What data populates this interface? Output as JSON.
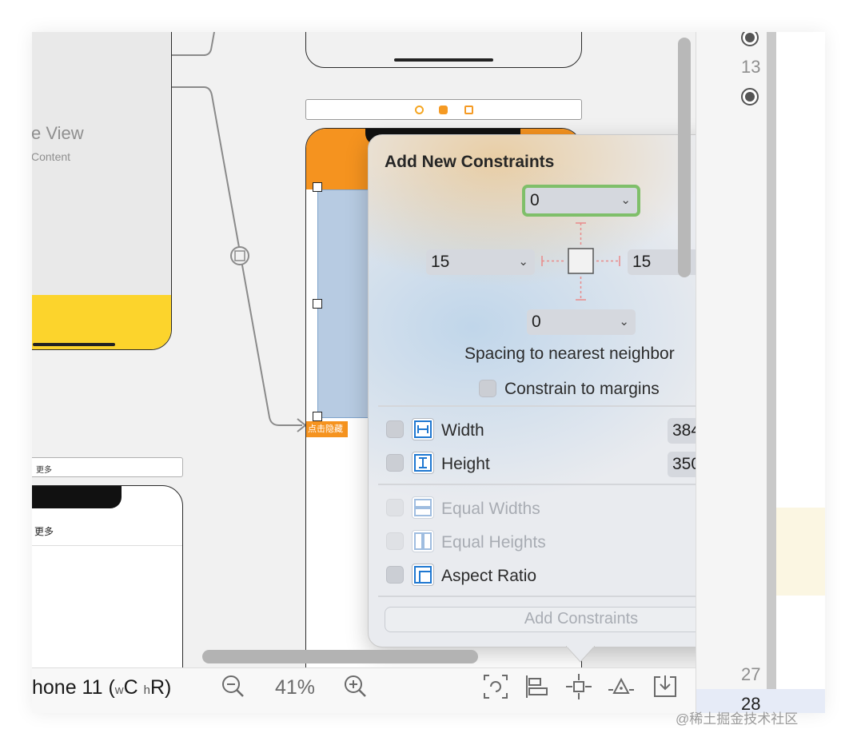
{
  "storyboard": {
    "left_scene": {
      "title_fragment": "e View",
      "subtitle_fragment": "Content"
    },
    "more_bar_label": "更多",
    "more_row_label": "更多",
    "selected_label": "点击隐藏",
    "colors": {
      "orange": "#f5931f",
      "yellow": "#fcd42c",
      "selection_blue": "#b7cbe2"
    }
  },
  "popover": {
    "title": "Add New Constraints",
    "top_value": "0",
    "left_value": "15",
    "right_value": "15",
    "bottom_value": "0",
    "spacing_caption": "Spacing to nearest neighbor",
    "constrain_margins_label": "Constrain to margins",
    "width_label": "Width",
    "width_value": "384",
    "height_label": "Height",
    "height_value": "350",
    "equal_widths_label": "Equal Widths",
    "equal_heights_label": "Equal Heights",
    "aspect_ratio_label": "Aspect Ratio",
    "add_button_label": "Add Constraints"
  },
  "bottom_bar": {
    "device_prefix": "hone 11 (",
    "w_small": "w",
    "w_big": "C",
    "h_small": "h",
    "h_big": "R)",
    "zoom": "41%"
  },
  "gutter": {
    "line_13": "13",
    "line_27": "27",
    "line_28": "28"
  },
  "watermark": "@稀土掘金技术社区",
  "icons": [
    "zoom-out-icon",
    "zoom-in-icon",
    "update-frames-icon",
    "align-icon",
    "add-constraints-icon",
    "resolve-issues-icon",
    "embed-in-icon",
    "chevron-down-icon",
    "width-constraint-icon",
    "height-constraint-icon",
    "equal-widths-icon",
    "equal-heights-icon",
    "aspect-ratio-icon"
  ]
}
